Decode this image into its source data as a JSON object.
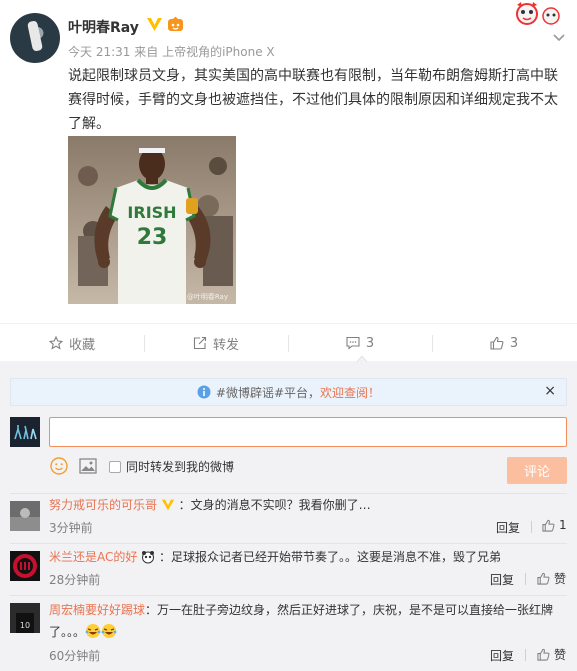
{
  "post": {
    "username": "叶明春Ray",
    "time": "今天 21:31",
    "source_prefix": "来自",
    "source": "上帝视角的iPhone X",
    "text": "说起限制球员文身，其实美国的高中联赛也有限制，当年勒布朗詹姆斯打高中联赛得时候，手臂的文身也被遮挡住，不过他们具体的限制原因和详细规定我不太了解。",
    "image": {
      "jersey_text": "IRISH",
      "jersey_number": "23",
      "watermark": "@叶明春Ray"
    }
  },
  "actions": {
    "favorite": "收藏",
    "repost": "转发",
    "comment_count": "3",
    "like_count": "3"
  },
  "notice": {
    "prefix": "#微博辟谣#平台，",
    "link": "欢迎查阅！",
    "close": "×"
  },
  "composer": {
    "input_value": "",
    "repost_checkbox_label": "同时转发到我的微博",
    "submit_label": "评论"
  },
  "comments": [
    {
      "name": "努力戒可乐的可乐哥",
      "text": "：文身的消息不实呗？我看你删了…",
      "time": "3分钟前",
      "reply": "回复",
      "like": "1",
      "badge": "verified"
    },
    {
      "name": "米兰还是AC的好",
      "text": "：足球报众记者已经开始带节奏了。。这要是消息不准，毁了兄弟",
      "time": "28分钟前",
      "reply": "回复",
      "like": "赞",
      "badge": "panda"
    },
    {
      "name": "周宏楠要好好踢球",
      "text": "：万一在肚子旁边纹身，然后正好进球了，庆祝，是不是可以直接给一张红牌了。。。",
      "time": "60分钟前",
      "reply": "回复",
      "like": "赞",
      "badge": ""
    }
  ],
  "colors": {
    "accent": "#eb7350",
    "verified": "#ffc000",
    "submit_disabled": "#fbbf9f",
    "notice_bg": "#eaf2fb"
  }
}
